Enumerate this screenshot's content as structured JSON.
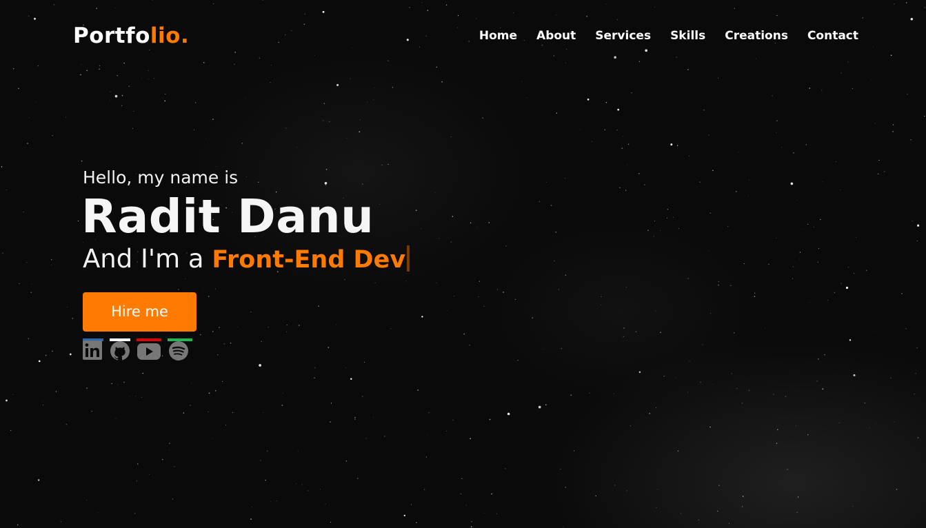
{
  "brand": {
    "logo_main": "Portfo",
    "logo_accent": "lio."
  },
  "nav": {
    "items": [
      {
        "label": "Home"
      },
      {
        "label": "About"
      },
      {
        "label": "Services"
      },
      {
        "label": "Skills"
      },
      {
        "label": "Creations"
      },
      {
        "label": "Contact"
      }
    ]
  },
  "hero": {
    "greeting": "Hello, my name is",
    "name": "Radit Danu",
    "role_prefix": "And I'm a",
    "role": "Front-End Dev",
    "cta_label": "Hire me"
  },
  "socials": [
    {
      "icon": "linkedin-icon",
      "accent_color": "#2867b2"
    },
    {
      "icon": "github-icon",
      "accent_color": "#ffffff"
    },
    {
      "icon": "youtube-icon",
      "accent_color": "#e00000"
    },
    {
      "icon": "spotify-icon",
      "accent_color": "#1db954"
    }
  ],
  "colors": {
    "accent": "#ff7a00",
    "background": "#0a0a0a",
    "text": "#ffffff",
    "icon_gray": "#777777"
  }
}
